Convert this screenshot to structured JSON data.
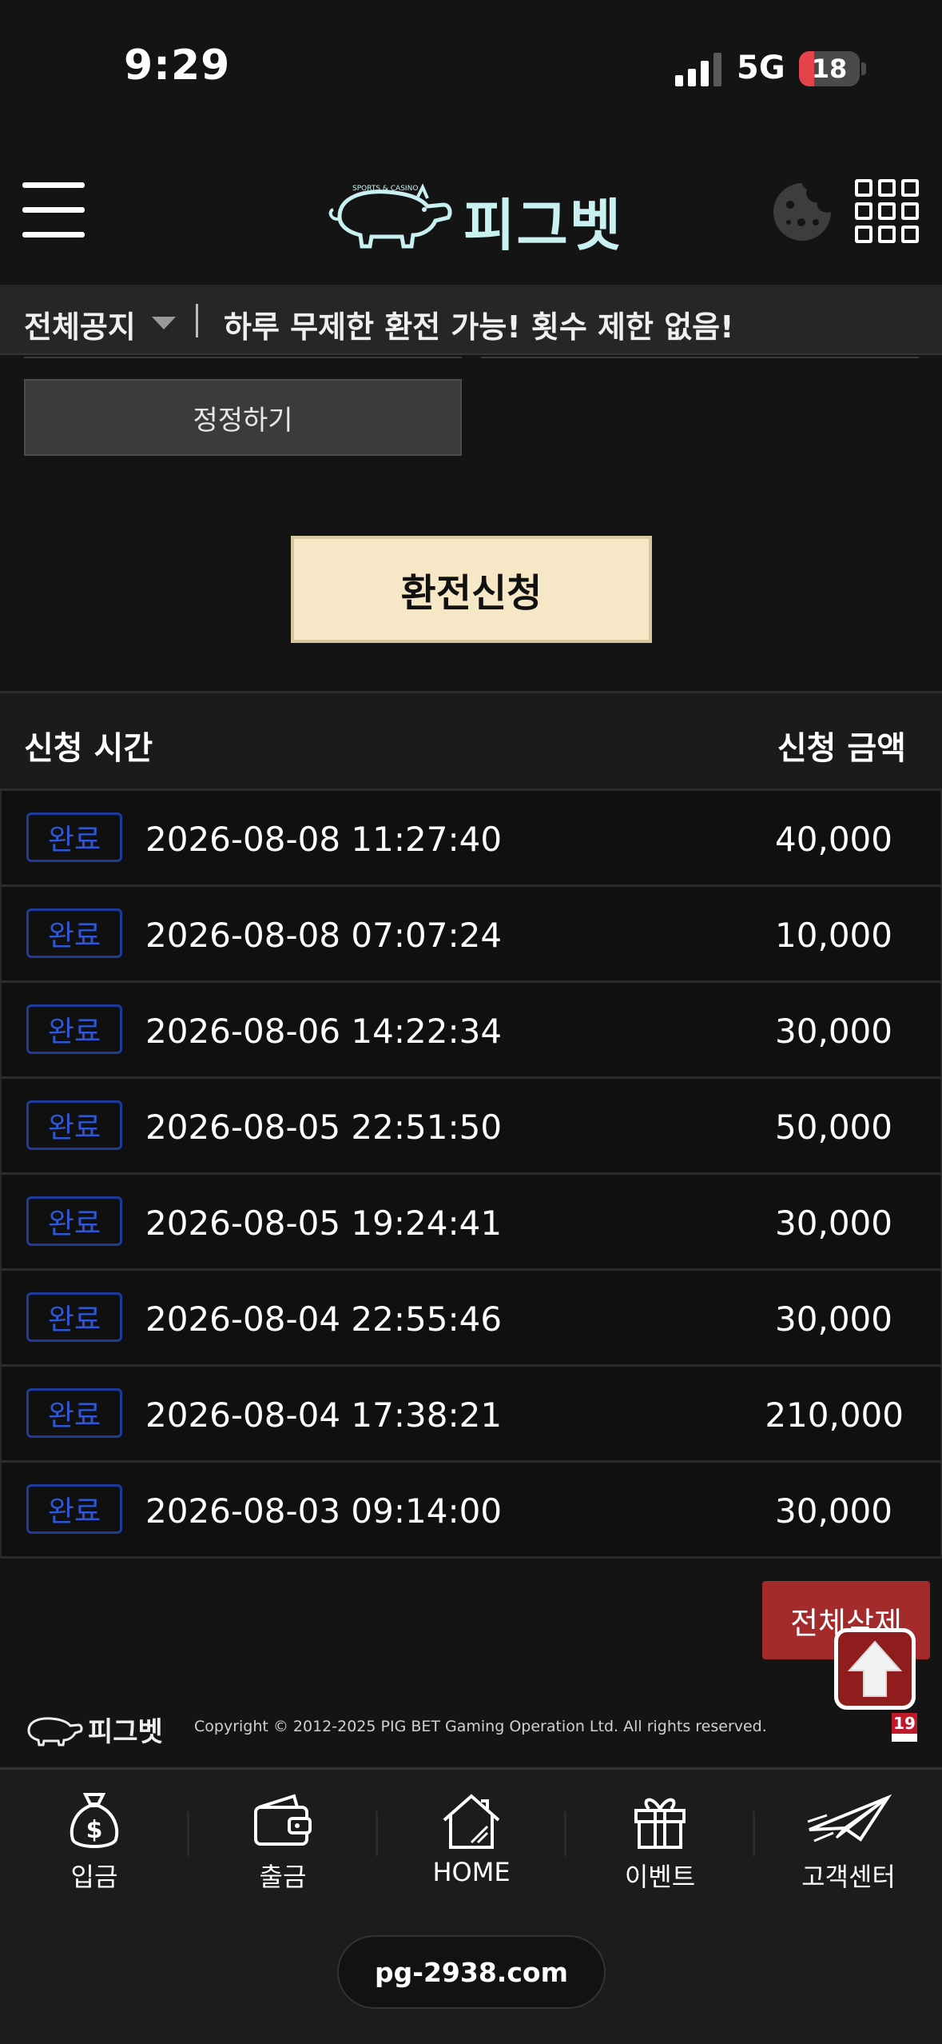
{
  "status_bar": {
    "time": "9:29",
    "network": "5G",
    "battery": "18"
  },
  "header": {
    "logo_text": "피그벳",
    "logo_small_text": "SPORTS & CASINO"
  },
  "notice": {
    "label": "전체공지",
    "text": "하루 무제한 환전 가능! 횟수 제한 없음!"
  },
  "form": {
    "correct_button": "정정하기",
    "apply_button": "환전신청"
  },
  "table": {
    "headers": {
      "time": "신청 시간",
      "amount": "신청 금액"
    },
    "rows": [
      {
        "status": "완료",
        "time": "2026-08-08 11:27:40",
        "amount": "40,000"
      },
      {
        "status": "완료",
        "time": "2026-08-08 07:07:24",
        "amount": "10,000"
      },
      {
        "status": "완료",
        "time": "2026-08-06 14:22:34",
        "amount": "30,000"
      },
      {
        "status": "완료",
        "time": "2026-08-05 22:51:50",
        "amount": "50,000"
      },
      {
        "status": "완료",
        "time": "2026-08-05 19:24:41",
        "amount": "30,000"
      },
      {
        "status": "완료",
        "time": "2026-08-04 22:55:46",
        "amount": "30,000"
      },
      {
        "status": "완료",
        "time": "2026-08-04 17:38:21",
        "amount": "210,000"
      },
      {
        "status": "완료",
        "time": "2026-08-03 09:14:00",
        "amount": "30,000"
      }
    ]
  },
  "delete_all_button": "전체삭제",
  "footer": {
    "logo_text": "피그벳",
    "copyright": "Copyright © 2012-2025 PIG BET Gaming Operation Ltd. All rights reserved.",
    "age_badge": "19"
  },
  "bottom_nav": [
    {
      "label": "입금",
      "icon": "money-bag-icon"
    },
    {
      "label": "출금",
      "icon": "wallet-icon"
    },
    {
      "label": "HOME",
      "icon": "home-icon"
    },
    {
      "label": "이벤트",
      "icon": "gift-icon"
    },
    {
      "label": "고객센터",
      "icon": "paper-plane-icon"
    }
  ],
  "url": "pg-2938.com",
  "colors": {
    "badge": "#2e56d6",
    "apply_button_bg": "#f6e7c6",
    "delete_button_bg": "#a32b2b",
    "logo": "#c9f1f1"
  }
}
